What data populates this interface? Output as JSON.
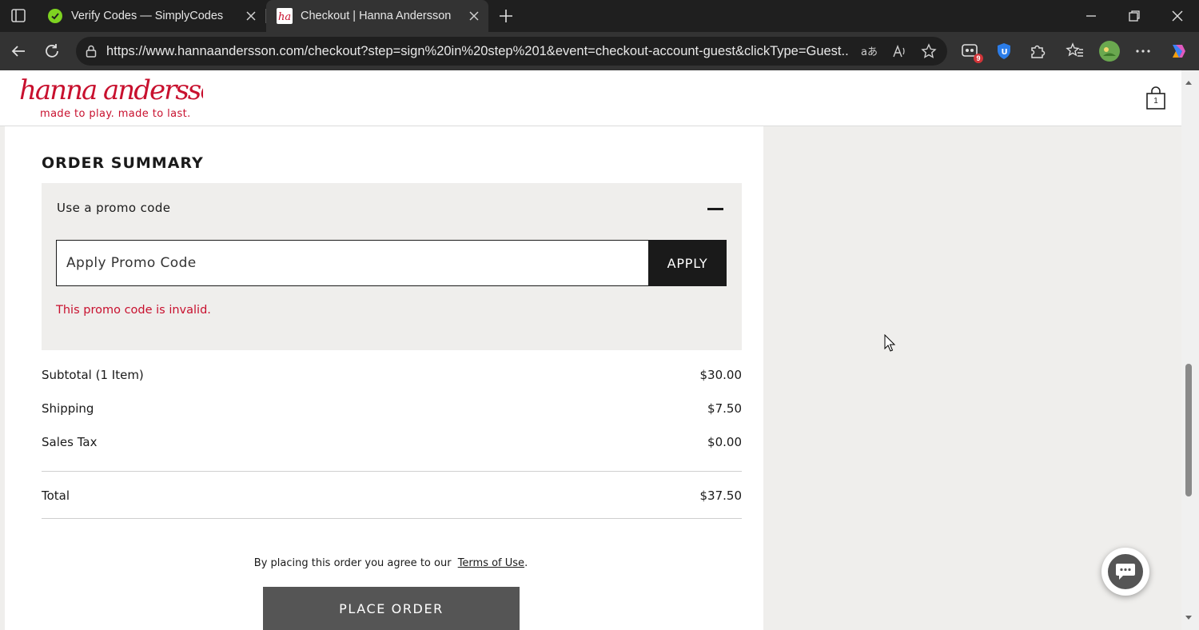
{
  "browser": {
    "tabs": [
      {
        "title": "Verify Codes — SimplyCodes",
        "active": false,
        "favicon": "simplycodes-favicon"
      },
      {
        "title": "Checkout | Hanna Andersson",
        "active": true,
        "favicon": "hanna-andersson-favicon"
      }
    ],
    "url": "https://www.hannaandersson.com/checkout?step=sign%20in%20step%201&event=checkout-account-guest&clickType=Guest...",
    "extension_badge": "9"
  },
  "site": {
    "logo_text": "hanna andersson",
    "tagline": "made to play. made to last.",
    "cart_count": "1"
  },
  "order_summary": {
    "title": "ORDER SUMMARY",
    "promo": {
      "label": "Use a promo code",
      "placeholder": "Apply Promo Code",
      "value": "",
      "apply_label": "APPLY",
      "error": "This promo code is invalid."
    },
    "rows": [
      {
        "label": "Subtotal (1 Item)",
        "value": "$30.00"
      },
      {
        "label": "Shipping",
        "value": "$7.50"
      },
      {
        "label": "Sales Tax",
        "value": "$0.00"
      }
    ],
    "total": {
      "label": "Total",
      "value": "$37.50"
    },
    "terms_prefix": "By placing this order you agree to our",
    "terms_link": "Terms of Use",
    "terms_suffix": ".",
    "place_order_label": "PLACE ORDER"
  },
  "colors": {
    "brand_red": "#c8102e",
    "dark": "#1a1a1a",
    "button_gray": "#555555",
    "panel_bg": "#efeeec"
  }
}
